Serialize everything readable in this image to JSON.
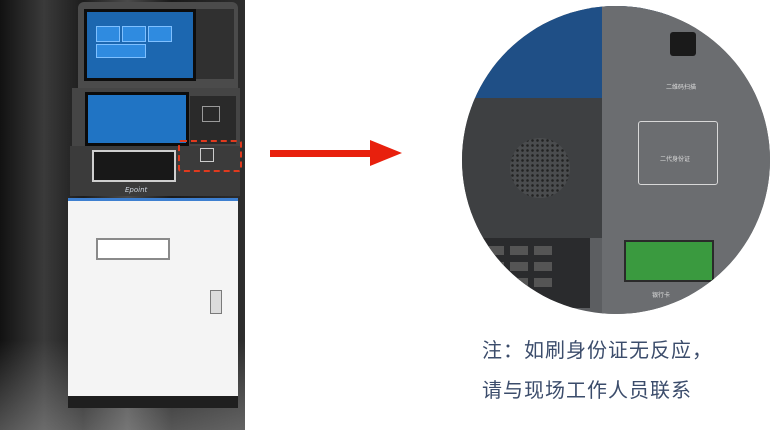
{
  "kiosk_image": {
    "brand_text": "Epoint"
  },
  "zoom_view": {
    "qr_label": "二维码扫描",
    "id_card_label": "二代身份证",
    "bank_card_label": "银行卡"
  },
  "note": {
    "line1": "注：如刷身份证无反应，",
    "line2": "请与现场工作人员联系"
  },
  "colors": {
    "arrow": "#e8200d",
    "highlight": "#e03a1e",
    "note_text": "#3b4c6b"
  }
}
